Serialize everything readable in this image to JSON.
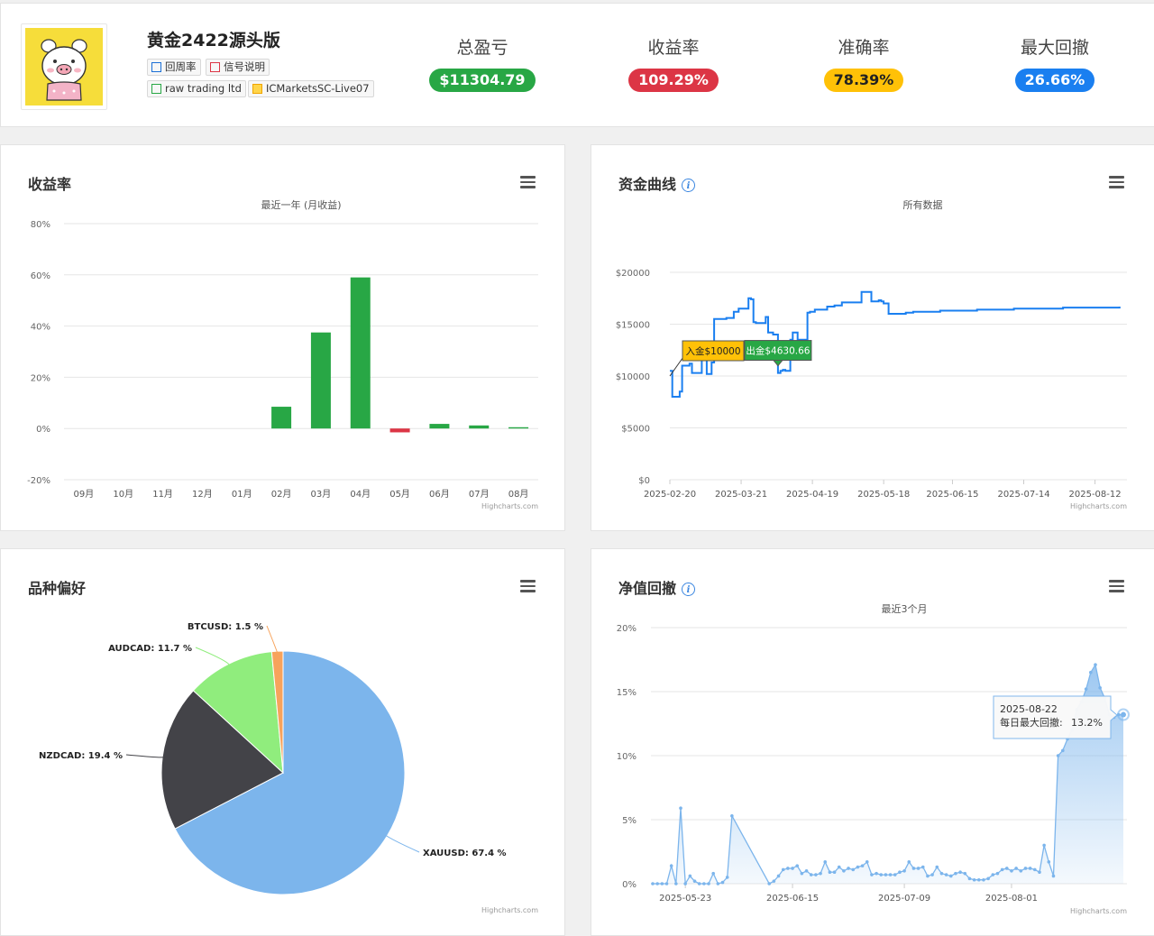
{
  "header": {
    "account_name": "黄金2422源头版",
    "tags": {
      "cycle": "回周率",
      "signal_desc": "信号说明",
      "broker": "raw trading ltd",
      "server": "ICMarketsSC-Live07"
    },
    "stats": [
      {
        "label": "总盈亏",
        "value": "$11304.79",
        "color": "#28a745"
      },
      {
        "label": "收益率",
        "value": "109.29%",
        "color": "#dc3545"
      },
      {
        "label": "准确率",
        "value": "78.39%",
        "color": "#ffc107"
      },
      {
        "label": "最大回撤",
        "value": "26.66%",
        "color": "#1a7ff0"
      }
    ]
  },
  "returns_card": {
    "title": "收益率",
    "credits": "Highcharts.com"
  },
  "equity_card": {
    "title": "资金曲线",
    "info_icon": "i",
    "credits": "Highcharts.com"
  },
  "symbol_card": {
    "title": "品种偏好",
    "credits": "Highcharts.com"
  },
  "drawdown_card": {
    "title": "净值回撤",
    "info_icon": "i",
    "credits": "Highcharts.com"
  },
  "chart_data": [
    {
      "type": "bar",
      "title": "最近一年 (月收益)",
      "categories": [
        "09月",
        "10月",
        "11月",
        "12月",
        "01月",
        "02月",
        "03月",
        "04月",
        "05月",
        "06月",
        "07月",
        "08月"
      ],
      "values": [
        0,
        0,
        0,
        0,
        0,
        8.5,
        37.5,
        59,
        -1.5,
        1.8,
        1.2,
        0.5
      ],
      "ylim": [
        -20,
        80
      ],
      "yticks": [
        -20,
        0,
        20,
        40,
        60,
        80
      ],
      "ytick_labels": [
        "-20%",
        "0%",
        "20%",
        "40%",
        "60%",
        "80%"
      ],
      "positive_color": "#28a745",
      "negative_color": "#dc3545",
      "grid": true
    },
    {
      "type": "line",
      "title": "所有数据",
      "x": [
        "2025-02-20",
        "2025-02-21",
        "2025-02-23",
        "2025-02-24",
        "2025-02-25",
        "2025-02-28",
        "2025-03-01",
        "2025-03-05",
        "2025-03-07",
        "2025-03-09",
        "2025-03-10",
        "2025-03-12",
        "2025-03-15",
        "2025-03-18",
        "2025-03-20",
        "2025-03-24",
        "2025-03-25",
        "2025-03-26",
        "2025-03-27",
        "2025-03-31",
        "2025-04-01",
        "2025-04-03",
        "2025-04-05",
        "2025-04-06",
        "2025-04-07",
        "2025-04-08",
        "2025-04-10",
        "2025-04-11",
        "2025-04-13",
        "2025-04-17",
        "2025-04-18",
        "2025-04-20",
        "2025-04-25",
        "2025-04-28",
        "2025-05-01",
        "2025-05-05",
        "2025-05-09",
        "2025-05-13",
        "2025-05-16",
        "2025-05-17",
        "2025-05-18",
        "2025-05-20",
        "2025-05-25",
        "2025-05-27",
        "2025-05-30",
        "2025-06-10",
        "2025-06-20",
        "2025-06-25",
        "2025-07-10",
        "2025-07-30",
        "2025-08-12",
        "2025-08-22"
      ],
      "y": [
        10500,
        8000,
        8000,
        8500,
        11000,
        11200,
        10300,
        12500,
        10200,
        11300,
        15500,
        15500,
        15600,
        16200,
        16500,
        17500,
        17400,
        15200,
        15100,
        15700,
        14200,
        14000,
        10300,
        10500,
        10600,
        10500,
        13500,
        14200,
        13500,
        16100,
        16200,
        16400,
        16700,
        16800,
        17100,
        17100,
        18100,
        17200,
        17300,
        17200,
        17000,
        16000,
        16000,
        16100,
        16200,
        16300,
        16300,
        16400,
        16500,
        16600,
        16600,
        16700
      ],
      "ylim": [
        0,
        22000
      ],
      "yticks": [
        0,
        5000,
        10000,
        15000,
        20000
      ],
      "ytick_labels": [
        "$0",
        "$5000",
        "$10000",
        "$15000",
        "$20000"
      ],
      "xticks": [
        "2025-02-20",
        "2025-03-21",
        "2025-04-19",
        "2025-05-18",
        "2025-06-15",
        "2025-07-14",
        "2025-08-12"
      ],
      "annotations": [
        {
          "x": "2025-02-20",
          "y": 10000,
          "label": "入金$10000",
          "color": "#ffc107"
        },
        {
          "x": "2025-04-05",
          "y": 10300,
          "label": "出金$4630.66",
          "color": "#28a745"
        }
      ],
      "line_color": "#1a7ff0",
      "grid": true
    },
    {
      "type": "pie",
      "slices": [
        {
          "name": "XAUUSD",
          "value": 67.4,
          "label": "XAUUSD: 67.4 %",
          "color": "#7cb5ec"
        },
        {
          "name": "NZDCAD",
          "value": 19.4,
          "label": "NZDCAD: 19.4 %",
          "color": "#434348"
        },
        {
          "name": "AUDCAD",
          "value": 11.7,
          "label": "AUDCAD: 11.7 %",
          "color": "#90ed7d"
        },
        {
          "name": "BTCUSD",
          "value": 1.5,
          "label": "BTCUSD: 1.5 %",
          "color": "#f7a35c"
        }
      ]
    },
    {
      "type": "area",
      "title": "最近3个月",
      "x": [
        "2025-05-16",
        "2025-05-17",
        "2025-05-18",
        "2025-05-19",
        "2025-05-20",
        "2025-05-21",
        "2025-05-22",
        "2025-05-23",
        "2025-05-24",
        "2025-05-25",
        "2025-05-26",
        "2025-05-27",
        "2025-05-28",
        "2025-05-29",
        "2025-05-30",
        "2025-05-31",
        "2025-06-01",
        "2025-06-02",
        "2025-06-10",
        "2025-06-11",
        "2025-06-12",
        "2025-06-13",
        "2025-06-14",
        "2025-06-15",
        "2025-06-16",
        "2025-06-17",
        "2025-06-18",
        "2025-06-19",
        "2025-06-20",
        "2025-06-21",
        "2025-06-22",
        "2025-06-23",
        "2025-06-24",
        "2025-06-25",
        "2025-06-26",
        "2025-06-27",
        "2025-06-28",
        "2025-06-29",
        "2025-06-30",
        "2025-07-01",
        "2025-07-02",
        "2025-07-03",
        "2025-07-04",
        "2025-07-05",
        "2025-07-06",
        "2025-07-07",
        "2025-07-08",
        "2025-07-09",
        "2025-07-10",
        "2025-07-11",
        "2025-07-12",
        "2025-07-13",
        "2025-07-14",
        "2025-07-15",
        "2025-07-16",
        "2025-07-17",
        "2025-07-18",
        "2025-07-19",
        "2025-07-20",
        "2025-07-21",
        "2025-07-22",
        "2025-07-23",
        "2025-07-24",
        "2025-07-25",
        "2025-07-26",
        "2025-07-27",
        "2025-07-28",
        "2025-07-29",
        "2025-07-30",
        "2025-07-31",
        "2025-08-01",
        "2025-08-02",
        "2025-08-03",
        "2025-08-04",
        "2025-08-05",
        "2025-08-06",
        "2025-08-07",
        "2025-08-08",
        "2025-08-09",
        "2025-08-10",
        "2025-08-11",
        "2025-08-12",
        "2025-08-13",
        "2025-08-14",
        "2025-08-15",
        "2025-08-16",
        "2025-08-17",
        "2025-08-18",
        "2025-08-19",
        "2025-08-20",
        "2025-08-21",
        "2025-08-22",
        "2025-08-23",
        "2025-08-24",
        "2025-08-25"
      ],
      "y": [
        0,
        0,
        0,
        0,
        1.4,
        0,
        5.9,
        0,
        0.6,
        0.2,
        0,
        0,
        0,
        0.8,
        0,
        0.1,
        0.5,
        5.3,
        0,
        0.2,
        0.6,
        1.1,
        1.2,
        1.2,
        1.4,
        0.8,
        1.0,
        0.7,
        0.7,
        0.8,
        1.7,
        0.9,
        0.9,
        1.3,
        1.0,
        1.2,
        1.1,
        1.3,
        1.4,
        1.7,
        0.7,
        0.8,
        0.7,
        0.7,
        0.7,
        0.7,
        0.9,
        1.0,
        1.7,
        1.2,
        1.2,
        1.3,
        0.6,
        0.7,
        1.3,
        0.8,
        0.7,
        0.6,
        0.8,
        0.9,
        0.8,
        0.4,
        0.3,
        0.3,
        0.3,
        0.4,
        0.7,
        0.8,
        1.1,
        1.2,
        1.0,
        1.2,
        1.0,
        1.2,
        1.2,
        1.1,
        0.9,
        3.0,
        1.7,
        0.6,
        10.0,
        10.4,
        11.3,
        12.0,
        13.6,
        14.2,
        15.2,
        16.5,
        17.1,
        15.3,
        14.5,
        13.2,
        13.0,
        13.2,
        13.2
      ],
      "ylim": [
        0,
        20
      ],
      "yticks": [
        0,
        5,
        10,
        15,
        20
      ],
      "ytick_labels": [
        "0%",
        "5%",
        "10%",
        "15%",
        "20%"
      ],
      "xticks": [
        "2025-05-23",
        "2025-06-15",
        "2025-07-09",
        "2025-08-01"
      ],
      "tooltip": {
        "date": "2025-08-22",
        "label": "每日最大回撤:",
        "value": "13.2%"
      },
      "line_color": "#7cb5ec",
      "grid": true
    }
  ]
}
